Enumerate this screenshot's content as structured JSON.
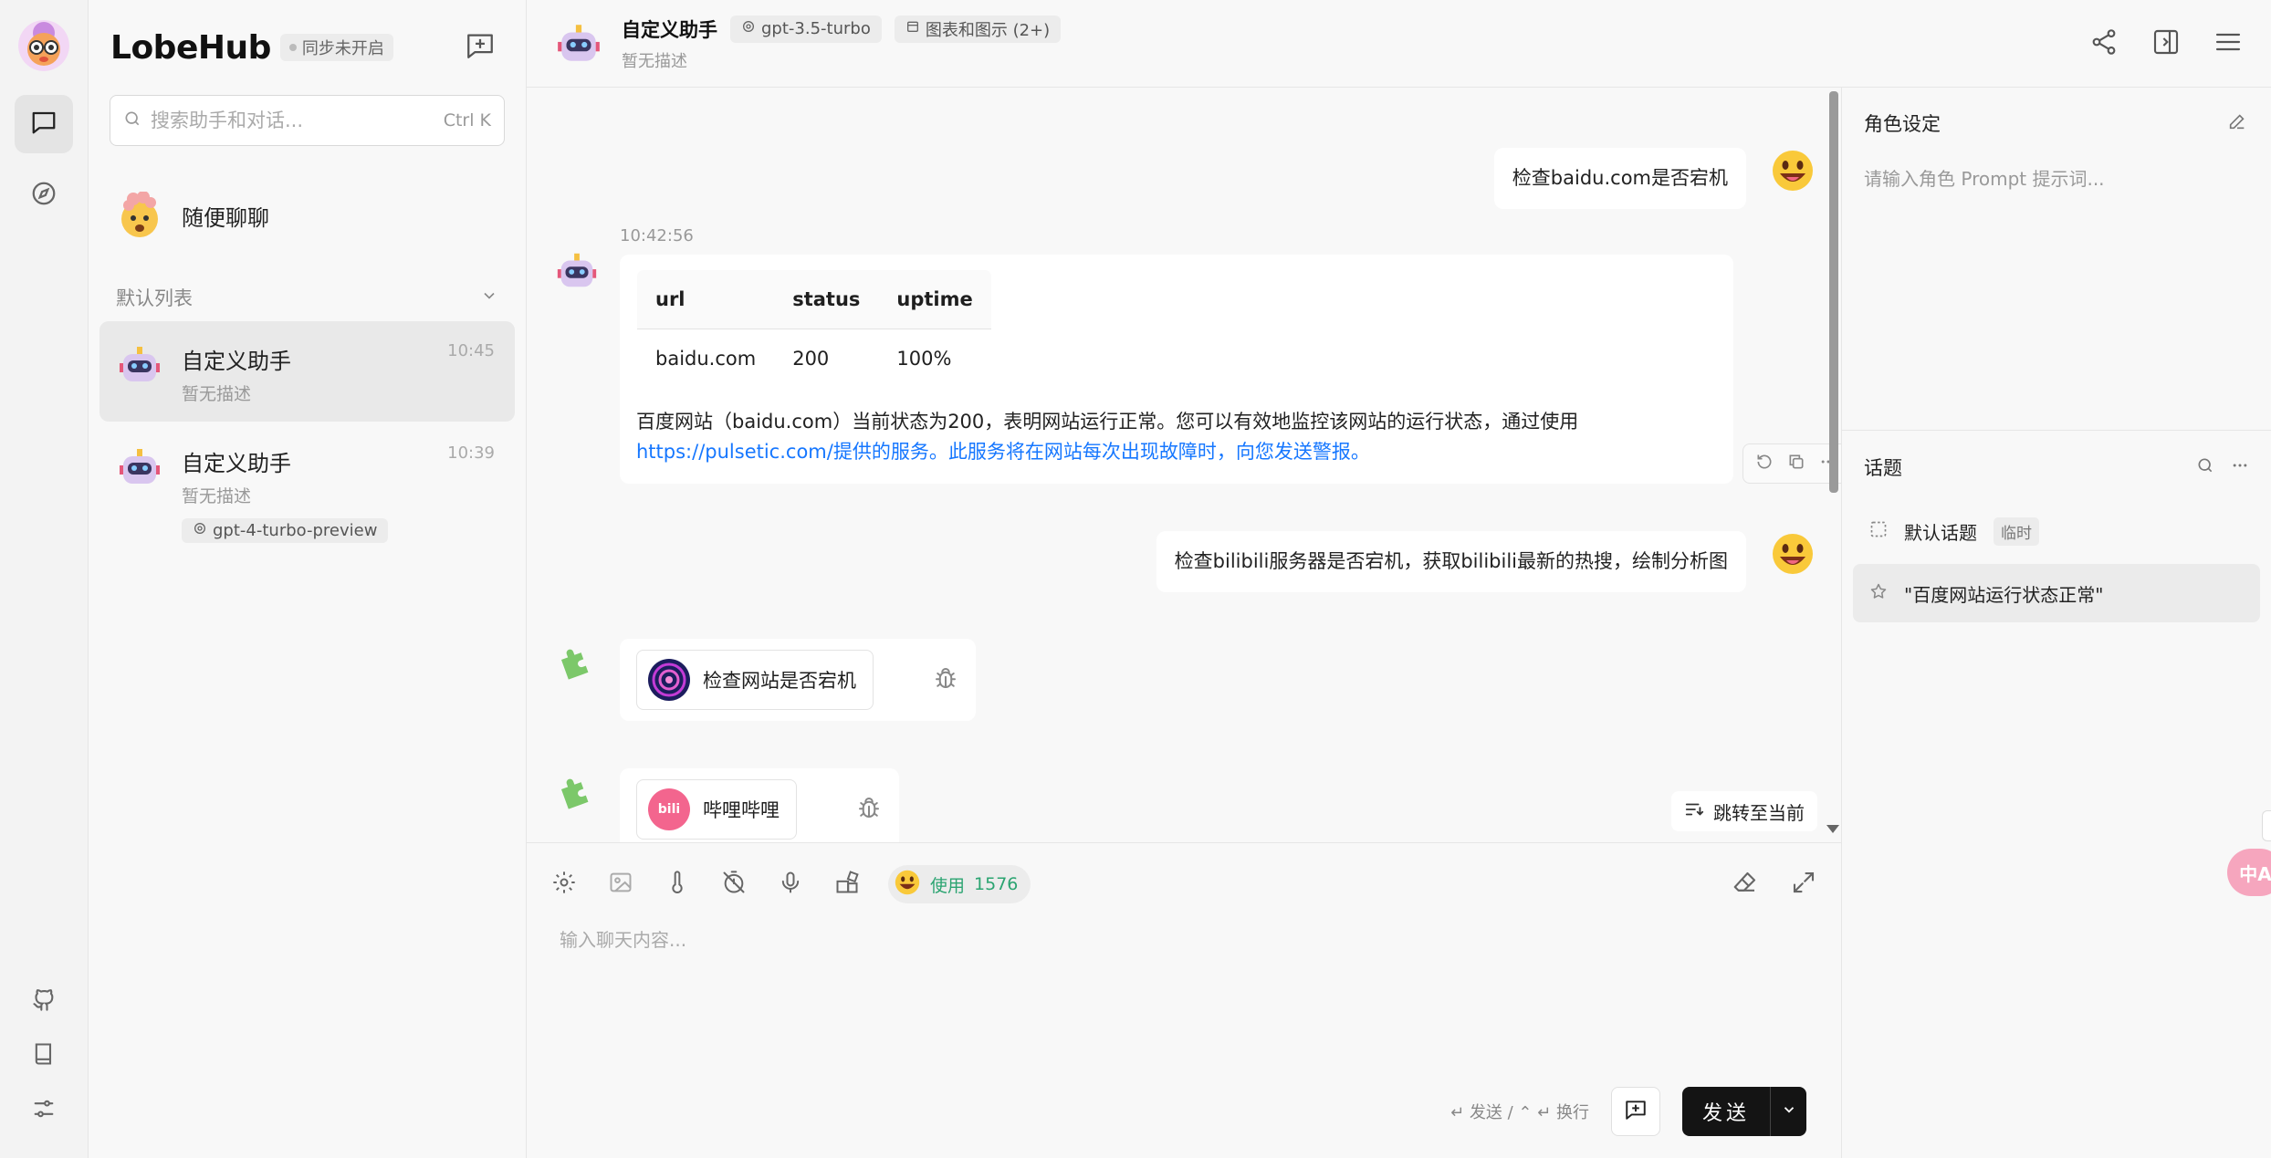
{
  "app": {
    "logo": "LobeHub",
    "sync_status": "同步未开启"
  },
  "search": {
    "placeholder": "搜索助手和对话...",
    "shortcut": "Ctrl K"
  },
  "sessions": {
    "random_chat": "随便聊聊",
    "group_label": "默认列表",
    "items": [
      {
        "title": "自定义助手",
        "desc": "暂无描述",
        "time": "10:45"
      },
      {
        "title": "自定义助手",
        "desc": "暂无描述",
        "time": "10:39",
        "model": "gpt-4-turbo-preview"
      }
    ]
  },
  "header": {
    "title": "自定义助手",
    "model": "gpt-3.5-turbo",
    "plugins": "图表和图示 (2+)",
    "desc": "暂无描述"
  },
  "messages": {
    "user1": "检查baidu.com是否宕机",
    "ai_time": "10:42:56",
    "table": {
      "headers": [
        "url",
        "status",
        "uptime"
      ],
      "row": [
        "baidu.com",
        "200",
        "100%"
      ]
    },
    "ai_text": "百度网站（baidu.com）当前状态为200，表明网站运行正常。您可以有效地监控该网站的运行状态，通过使用",
    "ai_link": "https://pulsetic.com/提供的服务。此服务将在网站每次出现故障时，向您发送警报。",
    "user2": "检查bilibili服务器是否宕机，获取bilibili最新的热搜，绘制分析图",
    "plugin1": "检查网站是否宕机",
    "plugin2": "哔哩哔哩",
    "jump": "跳转至当前"
  },
  "input": {
    "token_label": "使用",
    "token_count": "1576",
    "placeholder": "输入聊天内容...",
    "hint": "↵ 发送 / ⌃ ↵ 换行",
    "send": "发送"
  },
  "panel": {
    "role_title": "角色设定",
    "role_placeholder": "请输入角色 Prompt 提示词...",
    "topic_title": "话题",
    "topics": [
      {
        "label": "默认话题",
        "badge": "临时"
      },
      {
        "label": "\"百度网站运行状态正常\""
      }
    ]
  },
  "floating": {
    "translate": "中A"
  }
}
